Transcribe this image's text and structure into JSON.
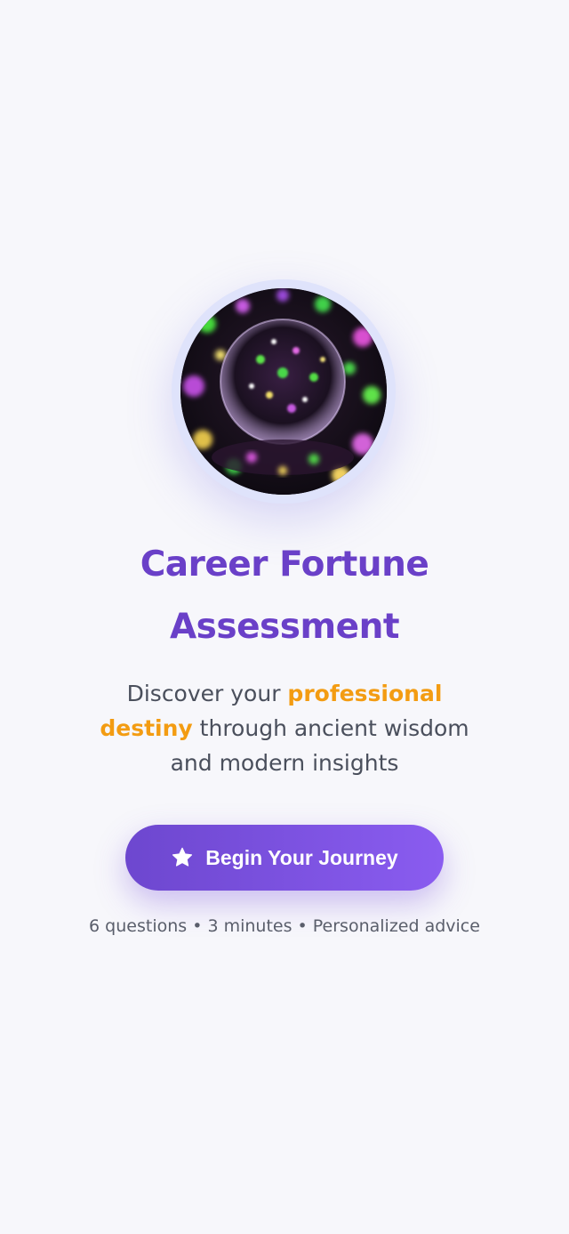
{
  "hero": {
    "image_alt": "crystal ball with colorful bokeh lights"
  },
  "title": {
    "line1": "Career Fortune",
    "line2": "Assessment"
  },
  "subtitle": {
    "part1": "Discover your ",
    "highlight": "professional destiny",
    "part2": " through ancient wisdom and modern insights"
  },
  "cta": {
    "label": "Begin Your Journey",
    "icon": "star-icon"
  },
  "meta": {
    "text": "6 questions • 3 minutes • Personalized advice"
  },
  "colors": {
    "title": "#6a40c8",
    "highlight": "#f39c12",
    "button_start": "#6d47cf",
    "button_end": "#8a5cf0",
    "background": "#f7f7fb"
  }
}
